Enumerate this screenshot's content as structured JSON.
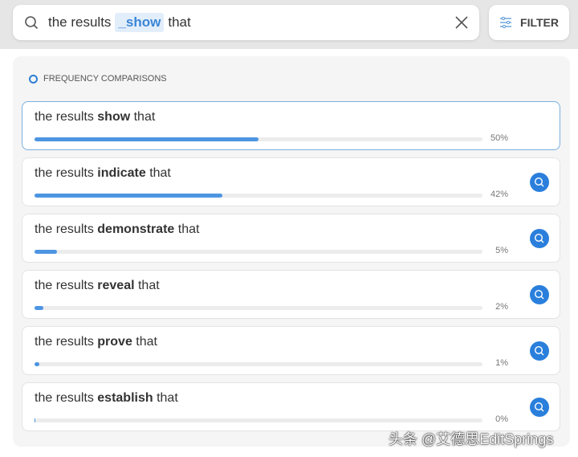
{
  "search": {
    "prefix": "the results",
    "highlight": "_show",
    "suffix": "that"
  },
  "filter_label": "FILTER",
  "section_title": "FREQUENCY COMPARISONS",
  "accent": "#2a7fdc",
  "results": [
    {
      "before": "the results",
      "word": "show",
      "after": "that",
      "percent": 50,
      "label": "50%",
      "selected": true
    },
    {
      "before": "the results",
      "word": "indicate",
      "after": "that",
      "percent": 42,
      "label": "42%"
    },
    {
      "before": "the results",
      "word": "demonstrate",
      "after": "that",
      "percent": 5,
      "label": "5%"
    },
    {
      "before": "the results",
      "word": "reveal",
      "after": "that",
      "percent": 2,
      "label": "2%"
    },
    {
      "before": "the results",
      "word": "prove",
      "after": "that",
      "percent": 1,
      "label": "1%"
    },
    {
      "before": "the results",
      "word": "establish",
      "after": "that",
      "percent": 0,
      "label": "0%"
    }
  ],
  "watermark": "头条 @艾德思EditSprings"
}
